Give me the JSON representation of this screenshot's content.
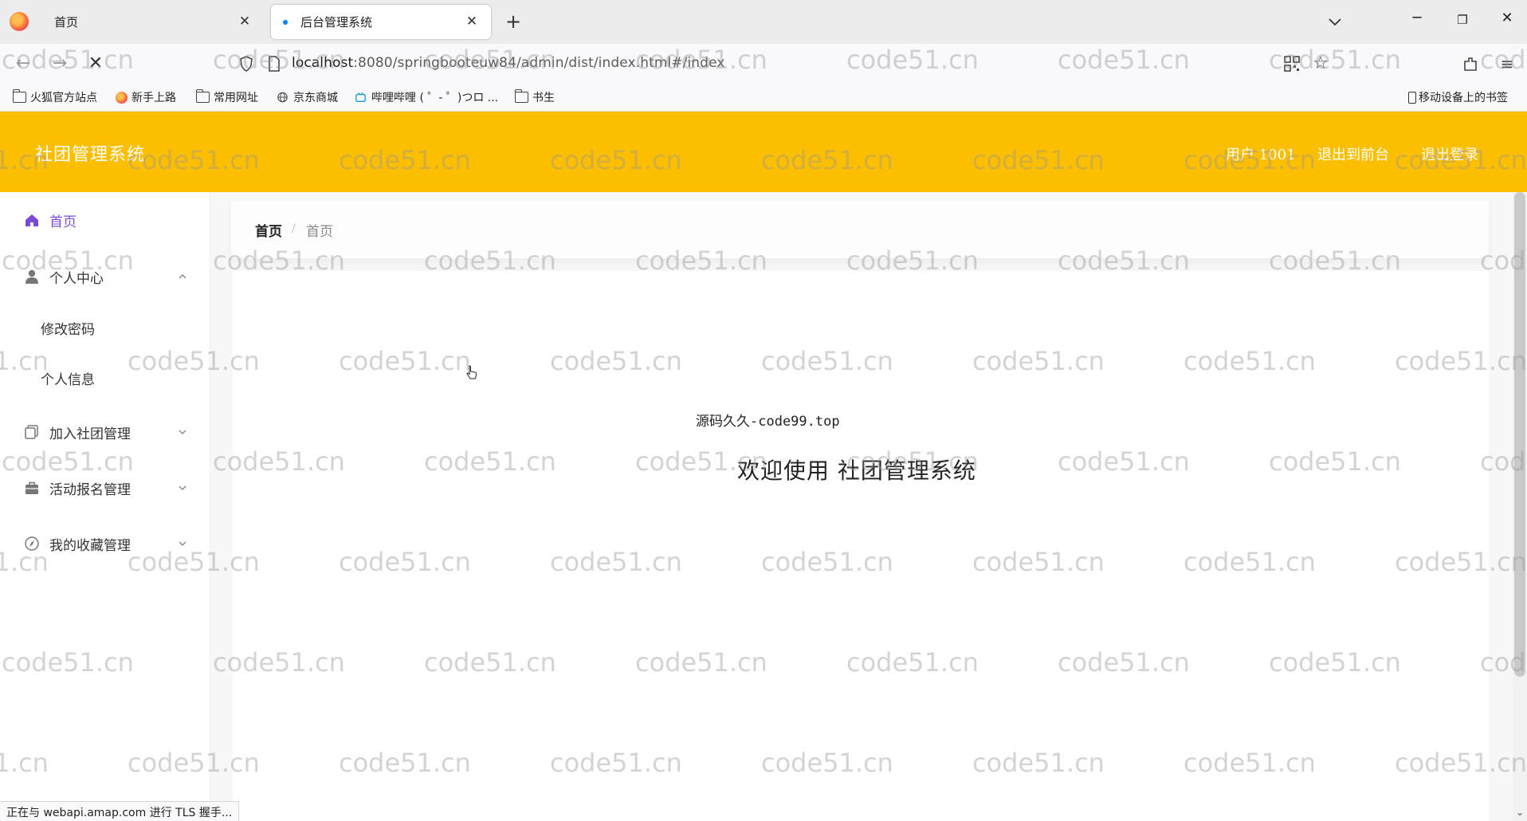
{
  "browser": {
    "tabs": [
      {
        "title": "首页",
        "active": false
      },
      {
        "title": "后台管理系统",
        "active": true
      }
    ],
    "url_host": "localhost",
    "url_rest": ":8080/springbooteuw84/admin/dist/index.html#/index",
    "bookmarks": [
      {
        "label": "火狐官方站点",
        "icon": "folder-icon"
      },
      {
        "label": "新手上路",
        "icon": "firefox-icon"
      },
      {
        "label": "常用网址",
        "icon": "folder-icon"
      },
      {
        "label": "京东商城",
        "icon": "globe-icon"
      },
      {
        "label": "哔哩哔哩 ( ゜- ゜)つロ ...",
        "icon": "bilibili-icon"
      },
      {
        "label": "书生",
        "icon": "folder-icon"
      }
    ],
    "mobile_bookmarks": "移动设备上的书签",
    "status": "正在与 webapi.amap.com 进行 TLS 握手..."
  },
  "app": {
    "title": "社团管理系统",
    "user": "用户 1001",
    "to_front": "退出到前台",
    "logout": "退出登录",
    "header_color": "#fcbf00",
    "accent_color": "#7a4ad6"
  },
  "sidebar": {
    "items": [
      {
        "label": "首页",
        "icon": "home-icon"
      },
      {
        "label": "个人中心",
        "icon": "user-icon",
        "expanded": true,
        "children": [
          {
            "label": "修改密码"
          },
          {
            "label": "个人信息"
          }
        ]
      },
      {
        "label": "加入社团管理",
        "icon": "copy-icon"
      },
      {
        "label": "活动报名管理",
        "icon": "briefcase-icon"
      },
      {
        "label": "我的收藏管理",
        "icon": "compass-icon"
      }
    ]
  },
  "breadcrumb": [
    "首页",
    "首页"
  ],
  "main": {
    "source": "源码久久-code99.top",
    "welcome": "欢迎使用 社团管理系统"
  },
  "watermark": "code51.cn"
}
